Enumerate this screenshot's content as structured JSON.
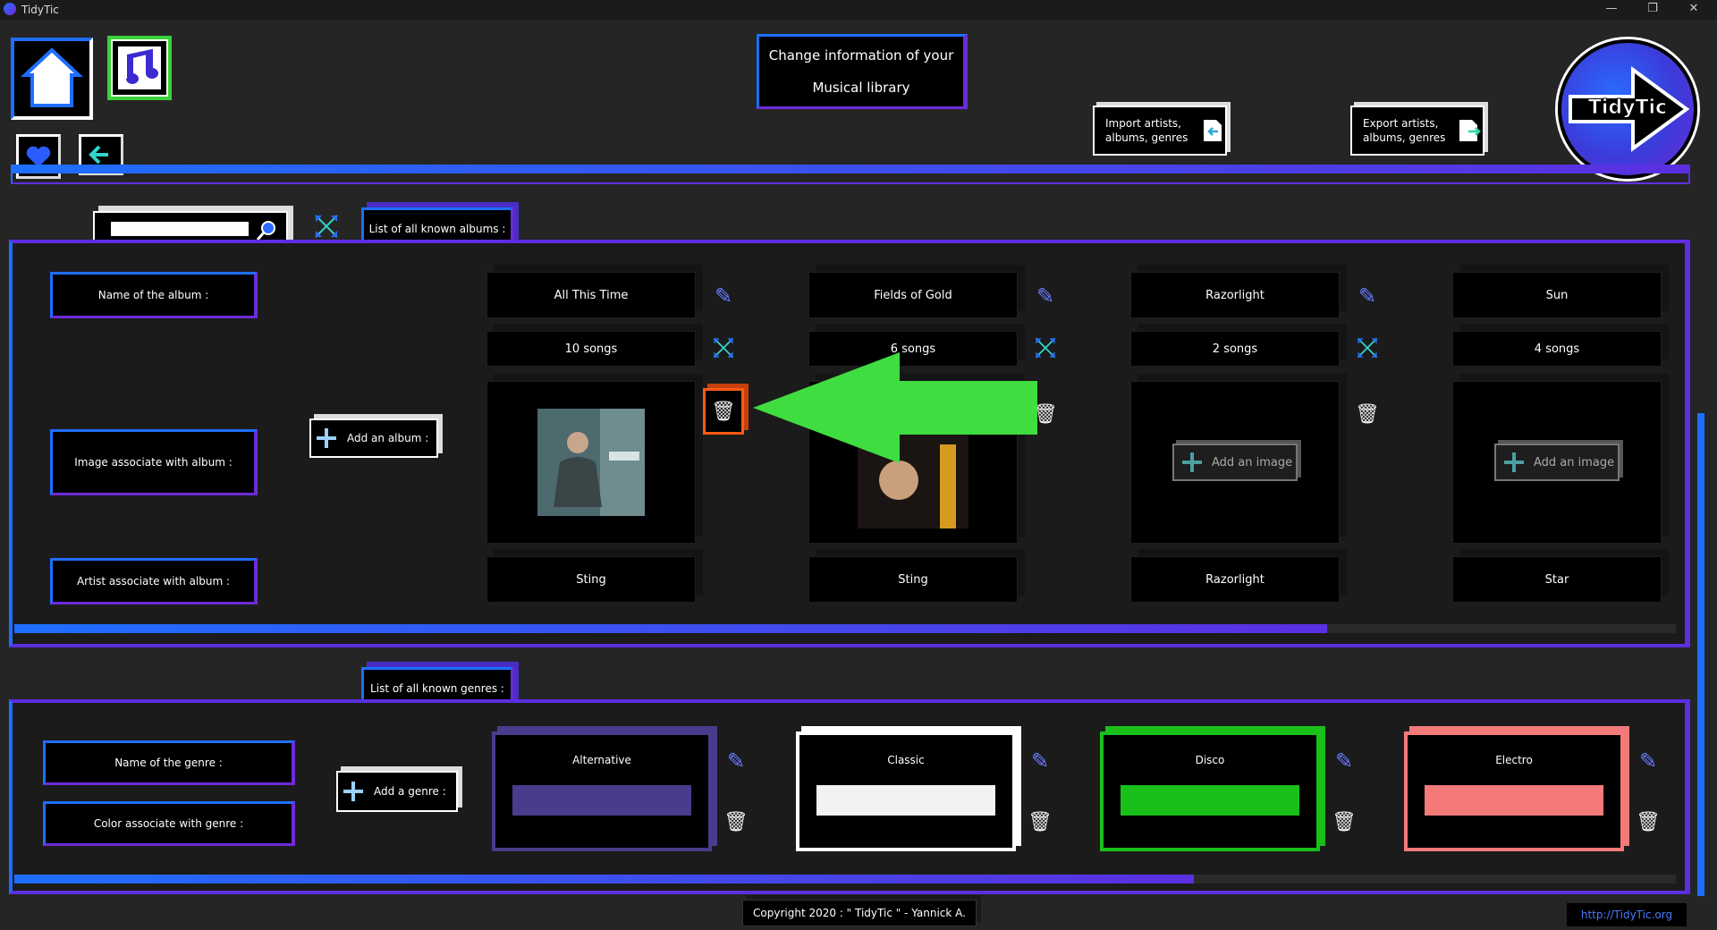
{
  "window": {
    "title": "TidyTic",
    "minimize": "—",
    "restore": "❐",
    "close": "✕"
  },
  "nav": {
    "home_icon": "home-icon",
    "music_edit_icon": "music-edit-icon",
    "favorite_icon": "heart-icon",
    "back_icon": "back-arrow-icon"
  },
  "header": {
    "title_line1": "Change information of your",
    "title_line2": "Musical library",
    "import_label_1": "Import artists,",
    "import_label_2": "albums, genres",
    "export_label_1": "Export artists,",
    "export_label_2": "albums, genres",
    "logo_text": "TidyTic"
  },
  "search": {
    "value": "",
    "placeholder": ""
  },
  "albums_section": {
    "tab_label": "List of all known albums :",
    "row_labels": {
      "name": "Name of the album :",
      "image": "Image associate with album :",
      "artist": "Artist associate with album :"
    },
    "add_album_label": "Add an album :",
    "add_image_label": "Add an image",
    "albums": [
      {
        "name": "All This Time",
        "songs": "10 songs",
        "artist": "Sting",
        "has_image": true
      },
      {
        "name": "Fields of Gold",
        "songs": "6 songs",
        "artist": "Sting",
        "has_image": true
      },
      {
        "name": "Razorlight",
        "songs": "2 songs",
        "artist": "Razorlight",
        "has_image": false
      },
      {
        "name": "Sun",
        "songs": "4 songs",
        "artist": "Star",
        "has_image": false
      }
    ],
    "scroll_progress": 0.79
  },
  "genres_section": {
    "tab_label": "List of all known genres :",
    "row_labels": {
      "name": "Name of the genre :",
      "color": "Color associate with genre :"
    },
    "add_genre_label": "Add a genre :",
    "genres": [
      {
        "name": "Alternative",
        "color": "#4a3b8c",
        "border": "#4a3b8c"
      },
      {
        "name": "Classic",
        "color": "#f2f2f2",
        "border": "#ffffff"
      },
      {
        "name": "Disco",
        "color": "#19c019",
        "border": "#19c019"
      },
      {
        "name": "Electro",
        "color": "#f47a7a",
        "border": "#f47a7a"
      }
    ],
    "scroll_progress": 0.71
  },
  "footer": {
    "copyright": "Copyright 2020 : \" TidyTic \" - Yannick A.",
    "link": "http://TidyTic.org"
  },
  "colors": {
    "accent_blue": "#1e6fff",
    "accent_purple": "#5b2fe0",
    "highlight_orange": "#ff5a14",
    "arrow_green": "#3fdd3f"
  }
}
